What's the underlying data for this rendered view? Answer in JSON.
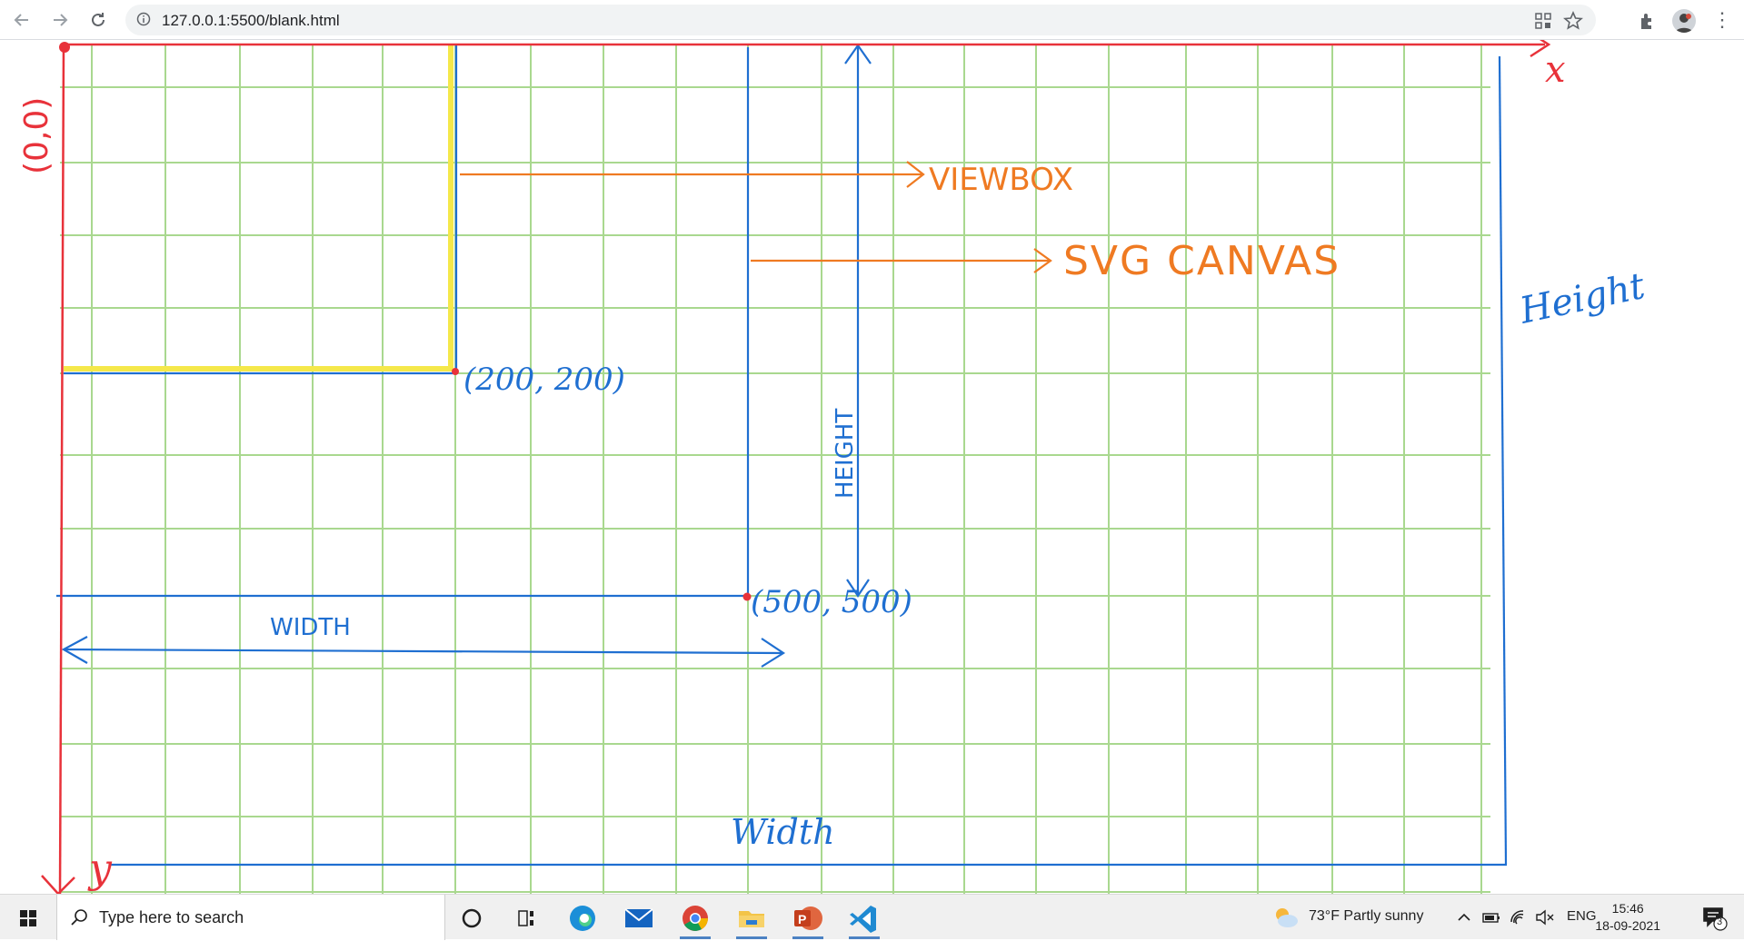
{
  "browser": {
    "url": "127.0.0.1:5500/blank.html",
    "back_icon": "back-arrow-icon",
    "forward_icon": "forward-arrow-icon",
    "reload_icon": "reload-icon"
  },
  "drawing": {
    "origin_label": "(0,0)",
    "x_label": "x",
    "y_label": "y",
    "point_200": "(200, 200)",
    "point_500": "(500, 500)",
    "viewbox_label": "VIEWBOX",
    "svg_canvas_label": "SVG CANVAS",
    "height_inner": "HEIGHT",
    "width_inner": "WIDTH",
    "height_outer": "Height",
    "width_outer": "Width",
    "colors": {
      "axes": "#e8323a",
      "blue": "#1f6fd1",
      "orange": "#ef7a22",
      "grid": "#a9d88f",
      "yellow": "#f5e84a"
    }
  },
  "taskbar": {
    "search_placeholder": "Type here to search",
    "weather": "73°F  Partly sunny",
    "language": "ENG",
    "time": "15:46",
    "date": "18-09-2021",
    "notification_count": "3",
    "apps": [
      "cortana",
      "task-view",
      "edge",
      "mail",
      "chrome",
      "file-explorer",
      "powerpoint",
      "vscode"
    ]
  }
}
